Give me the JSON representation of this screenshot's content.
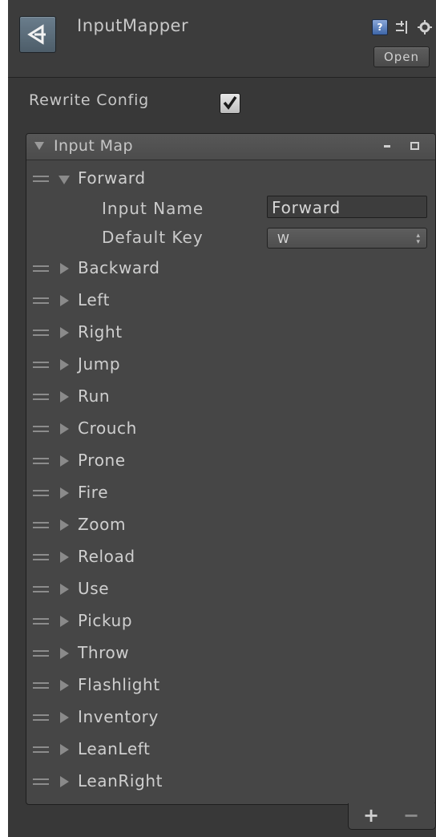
{
  "header": {
    "title": "InputMapper",
    "open_label": "Open",
    "help_glyph": "?",
    "icons": [
      "unity-logo-icon",
      "help-icon",
      "preset-icon",
      "gear-icon"
    ]
  },
  "config": {
    "rewrite_label": "Rewrite Config",
    "rewrite_checked": true
  },
  "input_map": {
    "title": "Input Map",
    "items": [
      "Forward",
      "Backward",
      "Left",
      "Right",
      "Jump",
      "Run",
      "Crouch",
      "Prone",
      "Fire",
      "Zoom",
      "Reload",
      "Use",
      "Pickup",
      "Throw",
      "Flashlight",
      "Inventory",
      "LeanLeft",
      "LeanRight"
    ],
    "expanded_item": {
      "input_name_label": "Input Name",
      "input_name_value": "Forward",
      "default_key_label": "Default Key",
      "default_key_value": "W"
    },
    "footer": {
      "add_label": "+",
      "remove_label": "−"
    }
  },
  "colors": {
    "background": "#383838",
    "panel": "#464646",
    "text": "#c8c8c8"
  }
}
